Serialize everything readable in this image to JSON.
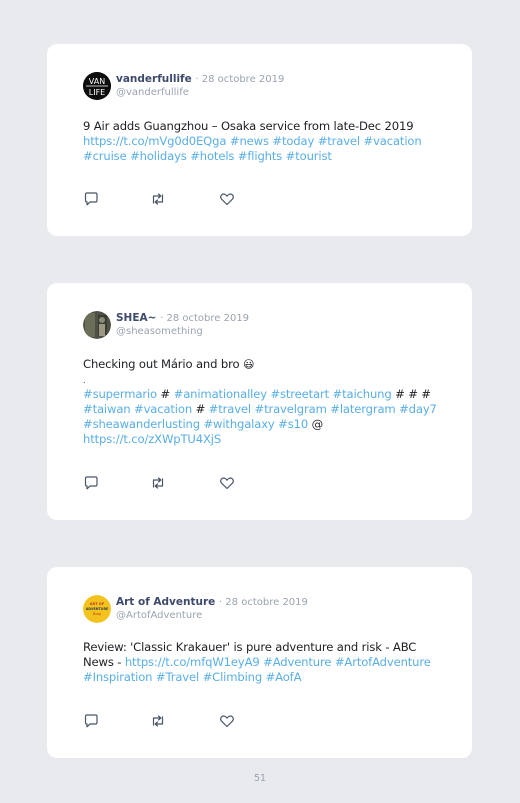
{
  "tweets": [
    {
      "avatar_text": [
        "VAN",
        "LIFE"
      ],
      "name": "vanderfullife",
      "date": "· 28 octobre 2019",
      "handle": "@vanderfullife",
      "text": "9 Air adds Guangzhou – Osaka service from late-Dec 2019",
      "link1": "https://t.co/mVg0d0EQga",
      "tags": "#news #today #travel #vacation #cruise #holidays #hotels #flights #tourist"
    },
    {
      "name": "SHEA~",
      "date": "· 28 octobre 2019",
      "handle": "@sheasomething",
      "text": "Checking out Mário and bro",
      "emoji": "😃",
      "dot": ".",
      "line_a_tags1": "#supermario",
      "line_a_hash1": " # ",
      "line_a_tags2": "#animationalley #streetart #taichung",
      "line_a_hash2": " # # #",
      "line_b_tags1": "#taiwan #vacation",
      "line_b_hash": " # ",
      "line_b_tags2": "#travel #travelgram #latergram #day7 #sheawanderlusting #withgalaxy #s10",
      "at": " @",
      "link1": "https://t.co/zXWpTU4XjS"
    },
    {
      "avatar_text": [
        "ART OF",
        "ADVENTURE",
        "Blog"
      ],
      "name": "Art of Adventure",
      "date": "· 28 octobre 2019",
      "handle": "@ArtofAdventure",
      "text": "Review: 'Classic Krakauer' is pure adventure and risk - ABC News -",
      "link1": "https://t.co/mfqW1eyA9",
      "tags": "#Adventure #ArtofAdventure #Inspiration #Travel #Climbing #AofA"
    }
  ],
  "page_number": "51",
  "colors": {
    "background": "#e8eaed",
    "card": "#ffffff",
    "link": "#5aaee6",
    "name": "#3d4a6b",
    "muted": "#9aa3b0",
    "icon": "#4a5566"
  }
}
